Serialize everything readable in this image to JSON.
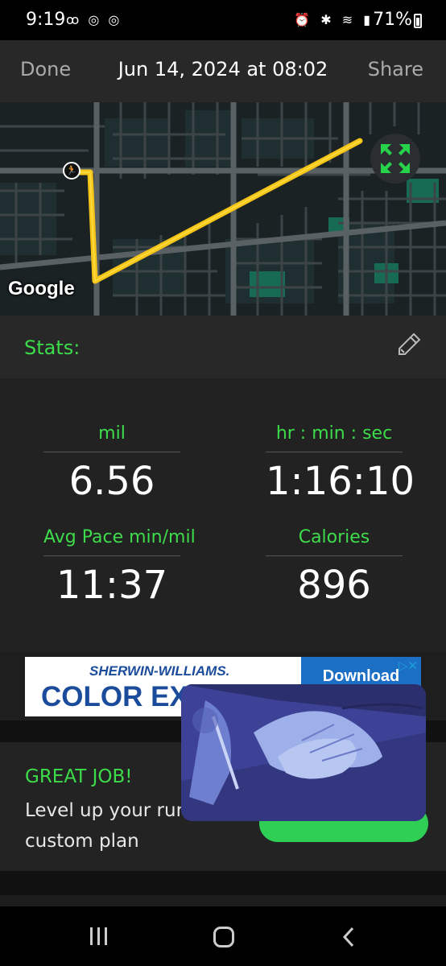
{
  "status_bar": {
    "time": "9:19",
    "left_icons": "ꝏ ◎ ◎",
    "right_icons": "⏰ ✱ ≋ ▮",
    "battery": "71%"
  },
  "header": {
    "done_label": "Done",
    "title": "Jun 14, 2024 at 08:02",
    "share_label": "Share"
  },
  "map": {
    "attribution": "Google",
    "route_color": "#f5c518",
    "runner_icon": "🏃",
    "expand_icon": "expand-icon"
  },
  "stats": {
    "header_label": "Stats:",
    "edit_icon": "pencil-icon",
    "distance": {
      "label": "mil",
      "value": "6.56"
    },
    "duration": {
      "label": "hr : min : sec",
      "value": "1:16:10"
    },
    "pace": {
      "label": "Avg Pace min/mil",
      "value": "11:37"
    },
    "calories": {
      "label": "Calories",
      "value": "896"
    }
  },
  "ad": {
    "brand": "SHERWIN-WILLIAMS.",
    "headline": "COLOR EX",
    "download_label": "Download",
    "choice_label": "▷✕"
  },
  "promo": {
    "title": "GREAT JOB!",
    "text": "Level up your run w a custom plan"
  },
  "colors": {
    "accent_green": "#3ddc4a",
    "route_yellow": "#f5c518",
    "ad_blue": "#1b4c9b"
  }
}
